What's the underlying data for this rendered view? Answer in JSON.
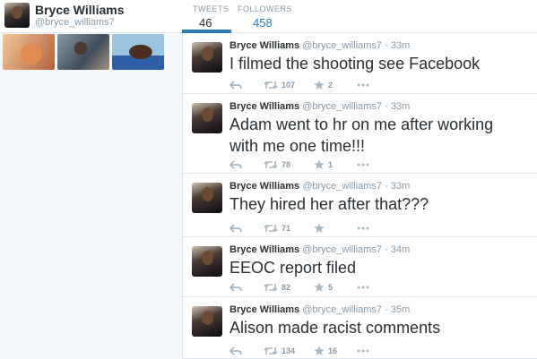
{
  "profile": {
    "name": "Bryce Williams",
    "handle": "@bryce_williams7"
  },
  "stats": {
    "tweets_label": "TWEETS",
    "tweets_value": "46",
    "followers_label": "FOLLOWERS",
    "followers_value": "458"
  },
  "colors": {
    "accent": "#2b7bb9",
    "muted": "#8899a6",
    "text": "#292f33"
  },
  "tweets": [
    {
      "name": "Bryce Williams",
      "handle": "@bryce_williams7",
      "dot": "·",
      "time": "33m",
      "text": "I filmed the shooting see Facebook",
      "retweets": "107",
      "favorites": "2"
    },
    {
      "name": "Bryce Williams",
      "handle": "@bryce_williams7",
      "dot": "·",
      "time": "33m",
      "text": "Adam went to hr on me after working with me one time!!!",
      "retweets": "78",
      "favorites": "1"
    },
    {
      "name": "Bryce Williams",
      "handle": "@bryce_williams7",
      "dot": "·",
      "time": "33m",
      "text": "They hired her after that???",
      "retweets": "71",
      "favorites": ""
    },
    {
      "name": "Bryce Williams",
      "handle": "@bryce_williams7",
      "dot": "·",
      "time": "34m",
      "text": "EEOC report filed",
      "retweets": "82",
      "favorites": "5"
    },
    {
      "name": "Bryce Williams",
      "handle": "@bryce_williams7",
      "dot": "·",
      "time": "35m",
      "text": "Alison made racist comments",
      "retweets": "134",
      "favorites": "16"
    }
  ]
}
